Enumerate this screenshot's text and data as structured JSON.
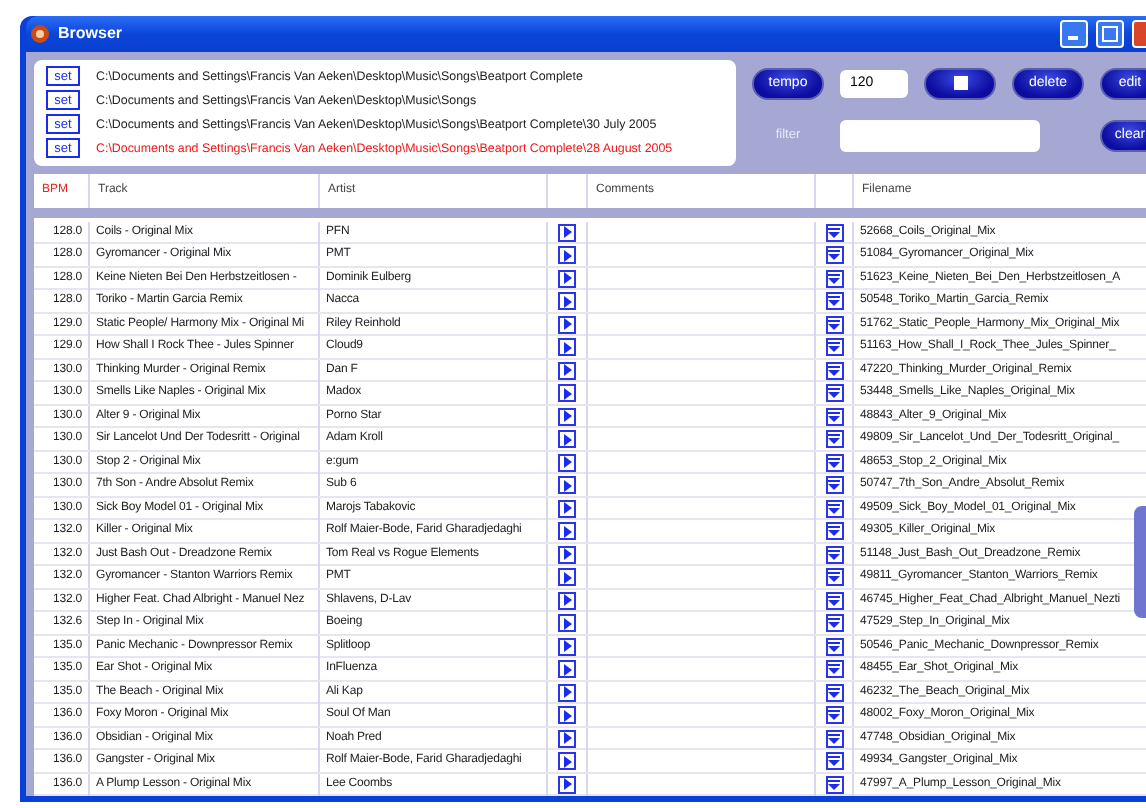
{
  "window": {
    "title": "Browser"
  },
  "folders": [
    {
      "button": "set",
      "path": "C:\\Documents and Settings\\Francis Van Aeken\\Desktop\\Music\\Songs\\Beatport Complete",
      "highlighted": false
    },
    {
      "button": "set",
      "path": "C:\\Documents and Settings\\Francis Van Aeken\\Desktop\\Music\\Songs",
      "highlighted": false
    },
    {
      "button": "set",
      "path": "C:\\Documents and Settings\\Francis Van Aeken\\Desktop\\Music\\Songs\\Beatport Complete\\30 July 2005",
      "highlighted": false
    },
    {
      "button": "set",
      "path": "C:\\Documents and Settings\\Francis Van Aeken\\Desktop\\Music\\Songs\\Beatport Complete\\28 August 2005",
      "highlighted": true
    }
  ],
  "controls": {
    "tempo_button": "tempo",
    "tempo_value": "120",
    "delete_button": "delete",
    "edit_button": "edit",
    "filter_label": "filter",
    "clear_button": "clear"
  },
  "columns": [
    {
      "label": "BPM",
      "sorted": true
    },
    {
      "label": "Track",
      "sorted": false
    },
    {
      "label": "Artist",
      "sorted": false
    },
    {
      "label": "Comments",
      "sorted": false
    },
    {
      "label": "Filename",
      "sorted": false
    }
  ],
  "rows": [
    {
      "bpm": "128.0",
      "track": "Coils - Original Mix",
      "artist": "PFN",
      "filename": "52668_Coils_Original_Mix"
    },
    {
      "bpm": "128.0",
      "track": "Gyromancer - Original Mix",
      "artist": "PMT",
      "filename": "51084_Gyromancer_Original_Mix"
    },
    {
      "bpm": "128.0",
      "track": "Keine Nieten Bei Den Herbstzeitlosen -",
      "artist": "Dominik Eulberg",
      "filename": "51623_Keine_Nieten_Bei_Den_Herbstzeitlosen_A"
    },
    {
      "bpm": "128.0",
      "track": "Toriko - Martin Garcia Remix",
      "artist": "Nacca",
      "filename": "50548_Toriko_Martin_Garcia_Remix"
    },
    {
      "bpm": "129.0",
      "track": "Static People/ Harmony Mix - Original Mi",
      "artist": "Riley Reinhold",
      "filename": "51762_Static_People_Harmony_Mix_Original_Mix"
    },
    {
      "bpm": "129.0",
      "track": "How Shall I Rock Thee - Jules Spinner",
      "artist": "Cloud9",
      "filename": "51163_How_Shall_I_Rock_Thee_Jules_Spinner_"
    },
    {
      "bpm": "130.0",
      "track": "Thinking Murder - Original Remix",
      "artist": "Dan F",
      "filename": "47220_Thinking_Murder_Original_Remix"
    },
    {
      "bpm": "130.0",
      "track": "Smells Like Naples - Original Mix",
      "artist": "Madox",
      "filename": "53448_Smells_Like_Naples_Original_Mix"
    },
    {
      "bpm": "130.0",
      "track": "Alter 9 - Original Mix",
      "artist": "Porno Star",
      "filename": "48843_Alter_9_Original_Mix"
    },
    {
      "bpm": "130.0",
      "track": "Sir Lancelot Und Der Todesritt - Original",
      "artist": "Adam Kroll",
      "filename": "49809_Sir_Lancelot_Und_Der_Todesritt_Original_"
    },
    {
      "bpm": "130.0",
      "track": "Stop 2 - Original Mix",
      "artist": "e:gum",
      "filename": "48653_Stop_2_Original_Mix"
    },
    {
      "bpm": "130.0",
      "track": "7th Son - Andre Absolut Remix",
      "artist": "Sub 6",
      "filename": "50747_7th_Son_Andre_Absolut_Remix"
    },
    {
      "bpm": "130.0",
      "track": "Sick Boy Model 01 - Original Mix",
      "artist": "Marojs Tabakovic",
      "filename": "49509_Sick_Boy_Model_01_Original_Mix"
    },
    {
      "bpm": "132.0",
      "track": "Killer - Original Mix",
      "artist": "Rolf Maier-Bode, Farid Gharadjedaghi",
      "filename": "49305_Killer_Original_Mix"
    },
    {
      "bpm": "132.0",
      "track": "Just Bash Out - Dreadzone Remix",
      "artist": "Tom Real vs Rogue Elements",
      "filename": "51148_Just_Bash_Out_Dreadzone_Remix"
    },
    {
      "bpm": "132.0",
      "track": "Gyromancer - Stanton Warriors Remix",
      "artist": "PMT",
      "filename": "49811_Gyromancer_Stanton_Warriors_Remix"
    },
    {
      "bpm": "132.0",
      "track": "Higher Feat. Chad Albright - Manuel Nez",
      "artist": "Shlavens, D-Lav",
      "filename": "46745_Higher_Feat_Chad_Albright_Manuel_Nezti"
    },
    {
      "bpm": "132.6",
      "track": "Step In - Original Mix",
      "artist": "Boeing",
      "filename": "47529_Step_In_Original_Mix"
    },
    {
      "bpm": "135.0",
      "track": "Panic Mechanic - Downpressor Remix",
      "artist": "Splitloop",
      "filename": "50546_Panic_Mechanic_Downpressor_Remix"
    },
    {
      "bpm": "135.0",
      "track": "Ear Shot - Original Mix",
      "artist": "InFluenza",
      "filename": "48455_Ear_Shot_Original_Mix"
    },
    {
      "bpm": "135.0",
      "track": "The Beach - Original Mix",
      "artist": "Ali Kap",
      "filename": "46232_The_Beach_Original_Mix"
    },
    {
      "bpm": "136.0",
      "track": "Foxy Moron - Original Mix",
      "artist": "Soul Of Man",
      "filename": "48002_Foxy_Moron_Original_Mix"
    },
    {
      "bpm": "136.0",
      "track": "Obsidian - Original Mix",
      "artist": "Noah Pred",
      "filename": "47748_Obsidian_Original_Mix"
    },
    {
      "bpm": "136.0",
      "track": "Gangster - Original Mix",
      "artist": "Rolf Maier-Bode, Farid Gharadjedaghi",
      "filename": "49934_Gangster_Original_Mix"
    },
    {
      "bpm": "136.0",
      "track": "A Plump Lesson - Original Mix",
      "artist": "Lee Coombs",
      "filename": "47997_A_Plump_Lesson_Original_Mix"
    }
  ]
}
